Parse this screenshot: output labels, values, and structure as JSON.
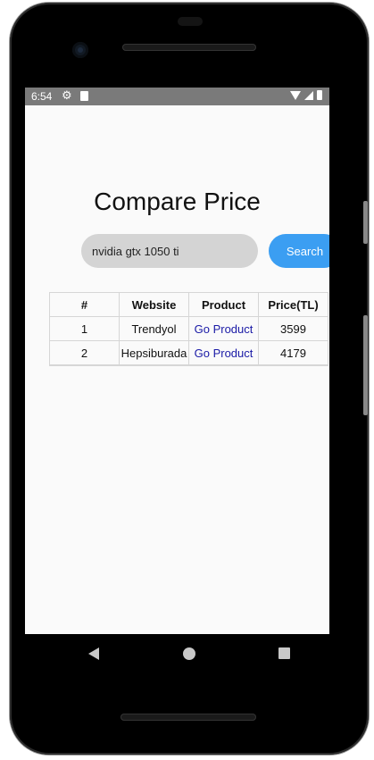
{
  "status": {
    "time": "6:54"
  },
  "app": {
    "title": "Compare Price"
  },
  "search": {
    "value": "nvidia gtx 1050 ti",
    "button_label": "Search"
  },
  "table": {
    "headers": [
      "#",
      "Website",
      "Product",
      "Price(TL)"
    ],
    "rows": [
      {
        "index": "1",
        "website": "Trendyol",
        "product": "Go Product",
        "price": "3599"
      },
      {
        "index": "2",
        "website": "Hepsiburada",
        "product": "Go Product",
        "price": "4179"
      }
    ]
  },
  "colors": {
    "accent": "#3b9ef2",
    "link": "#1a1aa6",
    "statusbar": "#7a7a7a"
  }
}
